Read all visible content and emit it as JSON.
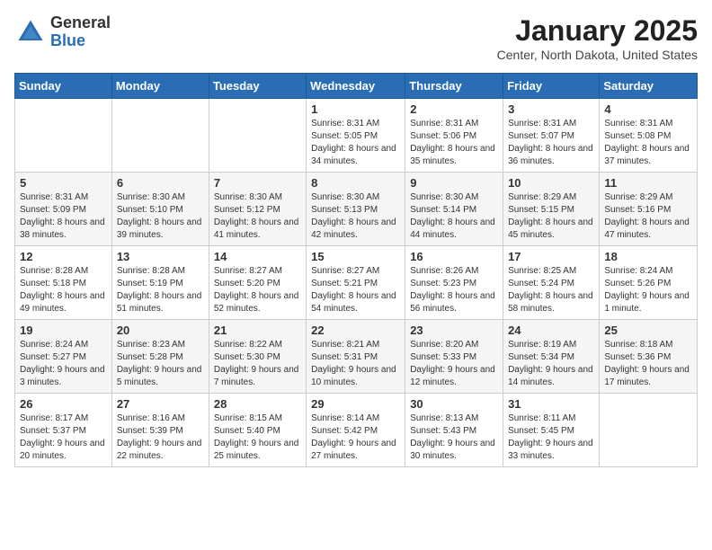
{
  "header": {
    "logo_general": "General",
    "logo_blue": "Blue",
    "month_title": "January 2025",
    "location": "Center, North Dakota, United States"
  },
  "weekdays": [
    "Sunday",
    "Monday",
    "Tuesday",
    "Wednesday",
    "Thursday",
    "Friday",
    "Saturday"
  ],
  "weeks": [
    [
      {
        "day": "",
        "sunrise": "",
        "sunset": "",
        "daylight": ""
      },
      {
        "day": "",
        "sunrise": "",
        "sunset": "",
        "daylight": ""
      },
      {
        "day": "",
        "sunrise": "",
        "sunset": "",
        "daylight": ""
      },
      {
        "day": "1",
        "sunrise": "Sunrise: 8:31 AM",
        "sunset": "Sunset: 5:05 PM",
        "daylight": "Daylight: 8 hours and 34 minutes."
      },
      {
        "day": "2",
        "sunrise": "Sunrise: 8:31 AM",
        "sunset": "Sunset: 5:06 PM",
        "daylight": "Daylight: 8 hours and 35 minutes."
      },
      {
        "day": "3",
        "sunrise": "Sunrise: 8:31 AM",
        "sunset": "Sunset: 5:07 PM",
        "daylight": "Daylight: 8 hours and 36 minutes."
      },
      {
        "day": "4",
        "sunrise": "Sunrise: 8:31 AM",
        "sunset": "Sunset: 5:08 PM",
        "daylight": "Daylight: 8 hours and 37 minutes."
      }
    ],
    [
      {
        "day": "5",
        "sunrise": "Sunrise: 8:31 AM",
        "sunset": "Sunset: 5:09 PM",
        "daylight": "Daylight: 8 hours and 38 minutes."
      },
      {
        "day": "6",
        "sunrise": "Sunrise: 8:30 AM",
        "sunset": "Sunset: 5:10 PM",
        "daylight": "Daylight: 8 hours and 39 minutes."
      },
      {
        "day": "7",
        "sunrise": "Sunrise: 8:30 AM",
        "sunset": "Sunset: 5:12 PM",
        "daylight": "Daylight: 8 hours and 41 minutes."
      },
      {
        "day": "8",
        "sunrise": "Sunrise: 8:30 AM",
        "sunset": "Sunset: 5:13 PM",
        "daylight": "Daylight: 8 hours and 42 minutes."
      },
      {
        "day": "9",
        "sunrise": "Sunrise: 8:30 AM",
        "sunset": "Sunset: 5:14 PM",
        "daylight": "Daylight: 8 hours and 44 minutes."
      },
      {
        "day": "10",
        "sunrise": "Sunrise: 8:29 AM",
        "sunset": "Sunset: 5:15 PM",
        "daylight": "Daylight: 8 hours and 45 minutes."
      },
      {
        "day": "11",
        "sunrise": "Sunrise: 8:29 AM",
        "sunset": "Sunset: 5:16 PM",
        "daylight": "Daylight: 8 hours and 47 minutes."
      }
    ],
    [
      {
        "day": "12",
        "sunrise": "Sunrise: 8:28 AM",
        "sunset": "Sunset: 5:18 PM",
        "daylight": "Daylight: 8 hours and 49 minutes."
      },
      {
        "day": "13",
        "sunrise": "Sunrise: 8:28 AM",
        "sunset": "Sunset: 5:19 PM",
        "daylight": "Daylight: 8 hours and 51 minutes."
      },
      {
        "day": "14",
        "sunrise": "Sunrise: 8:27 AM",
        "sunset": "Sunset: 5:20 PM",
        "daylight": "Daylight: 8 hours and 52 minutes."
      },
      {
        "day": "15",
        "sunrise": "Sunrise: 8:27 AM",
        "sunset": "Sunset: 5:21 PM",
        "daylight": "Daylight: 8 hours and 54 minutes."
      },
      {
        "day": "16",
        "sunrise": "Sunrise: 8:26 AM",
        "sunset": "Sunset: 5:23 PM",
        "daylight": "Daylight: 8 hours and 56 minutes."
      },
      {
        "day": "17",
        "sunrise": "Sunrise: 8:25 AM",
        "sunset": "Sunset: 5:24 PM",
        "daylight": "Daylight: 8 hours and 58 minutes."
      },
      {
        "day": "18",
        "sunrise": "Sunrise: 8:24 AM",
        "sunset": "Sunset: 5:26 PM",
        "daylight": "Daylight: 9 hours and 1 minute."
      }
    ],
    [
      {
        "day": "19",
        "sunrise": "Sunrise: 8:24 AM",
        "sunset": "Sunset: 5:27 PM",
        "daylight": "Daylight: 9 hours and 3 minutes."
      },
      {
        "day": "20",
        "sunrise": "Sunrise: 8:23 AM",
        "sunset": "Sunset: 5:28 PM",
        "daylight": "Daylight: 9 hours and 5 minutes."
      },
      {
        "day": "21",
        "sunrise": "Sunrise: 8:22 AM",
        "sunset": "Sunset: 5:30 PM",
        "daylight": "Daylight: 9 hours and 7 minutes."
      },
      {
        "day": "22",
        "sunrise": "Sunrise: 8:21 AM",
        "sunset": "Sunset: 5:31 PM",
        "daylight": "Daylight: 9 hours and 10 minutes."
      },
      {
        "day": "23",
        "sunrise": "Sunrise: 8:20 AM",
        "sunset": "Sunset: 5:33 PM",
        "daylight": "Daylight: 9 hours and 12 minutes."
      },
      {
        "day": "24",
        "sunrise": "Sunrise: 8:19 AM",
        "sunset": "Sunset: 5:34 PM",
        "daylight": "Daylight: 9 hours and 14 minutes."
      },
      {
        "day": "25",
        "sunrise": "Sunrise: 8:18 AM",
        "sunset": "Sunset: 5:36 PM",
        "daylight": "Daylight: 9 hours and 17 minutes."
      }
    ],
    [
      {
        "day": "26",
        "sunrise": "Sunrise: 8:17 AM",
        "sunset": "Sunset: 5:37 PM",
        "daylight": "Daylight: 9 hours and 20 minutes."
      },
      {
        "day": "27",
        "sunrise": "Sunrise: 8:16 AM",
        "sunset": "Sunset: 5:39 PM",
        "daylight": "Daylight: 9 hours and 22 minutes."
      },
      {
        "day": "28",
        "sunrise": "Sunrise: 8:15 AM",
        "sunset": "Sunset: 5:40 PM",
        "daylight": "Daylight: 9 hours and 25 minutes."
      },
      {
        "day": "29",
        "sunrise": "Sunrise: 8:14 AM",
        "sunset": "Sunset: 5:42 PM",
        "daylight": "Daylight: 9 hours and 27 minutes."
      },
      {
        "day": "30",
        "sunrise": "Sunrise: 8:13 AM",
        "sunset": "Sunset: 5:43 PM",
        "daylight": "Daylight: 9 hours and 30 minutes."
      },
      {
        "day": "31",
        "sunrise": "Sunrise: 8:11 AM",
        "sunset": "Sunset: 5:45 PM",
        "daylight": "Daylight: 9 hours and 33 minutes."
      },
      {
        "day": "",
        "sunrise": "",
        "sunset": "",
        "daylight": ""
      }
    ]
  ]
}
